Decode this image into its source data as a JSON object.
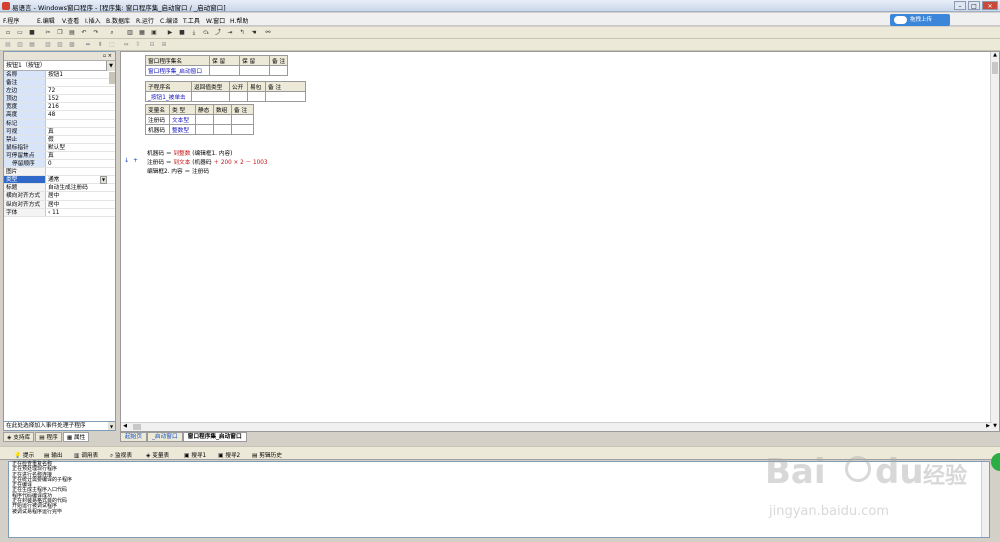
{
  "window": {
    "title": "易语言 - Windows窗口程序 - [程序集: 窗口程序集_启动窗口 / _启动窗口]"
  },
  "menu": [
    "F.程序",
    "E.编辑",
    "V.查看",
    "I.插入",
    "B.数据库",
    "R.运行",
    "C.编译",
    "T.工具",
    "W.窗口",
    "H.帮助"
  ],
  "cloud_button": "拖拽上传",
  "left_panel": {
    "selector": "按钮1（按钮）",
    "properties": [
      {
        "key": "名称",
        "value": "按钮1"
      },
      {
        "key": "备注",
        "value": ""
      },
      {
        "key": "左边",
        "value": "72"
      },
      {
        "key": "顶边",
        "value": "152"
      },
      {
        "key": "宽度",
        "value": "216"
      },
      {
        "key": "高度",
        "value": "48"
      },
      {
        "key": "标记",
        "value": ""
      },
      {
        "key": "可视",
        "value": "真"
      },
      {
        "key": "禁止",
        "value": "假"
      },
      {
        "key": "鼠标指针",
        "value": "默认型"
      },
      {
        "key": "可停留焦点",
        "value": "真"
      },
      {
        "key": "停留顺序",
        "value": "0"
      },
      {
        "key": "图片",
        "value": ""
      },
      {
        "key": "类型",
        "value": "通常"
      },
      {
        "key": "标题",
        "value": "自动生成注册码"
      },
      {
        "key": "横向对齐方式",
        "value": "居中"
      },
      {
        "key": "纵向对齐方式",
        "value": "居中"
      },
      {
        "key": "字体",
        "value": "‹ 11"
      }
    ],
    "event_hint": "在此处选择加入事件处理子程序",
    "tabs": [
      "支持库",
      "程序",
      "属性"
    ]
  },
  "editor": {
    "assembly_table": {
      "headers": [
        "窗口程序集名",
        "保 留",
        "保 留",
        "备 注"
      ],
      "row": [
        "窗口程序集_启动窗口",
        "",
        "",
        ""
      ]
    },
    "sub_table": {
      "headers": [
        "子程序名",
        "返回值类型",
        "公开",
        "易包",
        "备 注"
      ],
      "row": [
        "_按钮1_被单击",
        "",
        "",
        "",
        ""
      ]
    },
    "var_table": {
      "headers": [
        "变量名",
        "类 型",
        "静态",
        "数组",
        "备 注"
      ],
      "rows": [
        [
          "注册码",
          "文本型",
          "",
          "",
          ""
        ],
        [
          "机器码",
          "整数型",
          "",
          "",
          ""
        ]
      ]
    },
    "code": [
      {
        "a": "机器码 ＝ ",
        "b": "到整数",
        "c": " (编辑框1. 内容)",
        "d": ""
      },
      {
        "a": "注册码 ＝ ",
        "b": "到文本",
        "c": " (机器码 ",
        "d": "＋ 200 × 2 － 1003"
      },
      {
        "a": "编辑框2. 内容 ＝ 注册码",
        "b": "",
        "c": "",
        "d": ""
      }
    ],
    "tabs": [
      "起始页",
      "_启动窗口",
      "窗口程序集_启动窗口"
    ]
  },
  "output": {
    "tabs": [
      "提示",
      "输出",
      "调用表",
      "监视表",
      "变量表",
      "搜寻1",
      "搜寻2",
      "剪辑历史"
    ],
    "lines": [
      "正在检查重复名称",
      "正在预处理现行程序",
      "正在进行名称连接",
      "正在统计需要编译的子程序",
      "正在编译",
      "正在生成主程序入口代码",
      "程序代码编译成功",
      "正在封装易格式目的代码",
      "开始运行被调试程序",
      "被调试易程序运行完毕"
    ]
  },
  "watermark": {
    "brand": "Bai",
    "brand2": "du",
    "cn": "经验",
    "url": "jingyan.baidu.com"
  },
  "colors": {
    "keyword": "#c01010",
    "type": "#1010c0",
    "selection": "#3069c8"
  }
}
